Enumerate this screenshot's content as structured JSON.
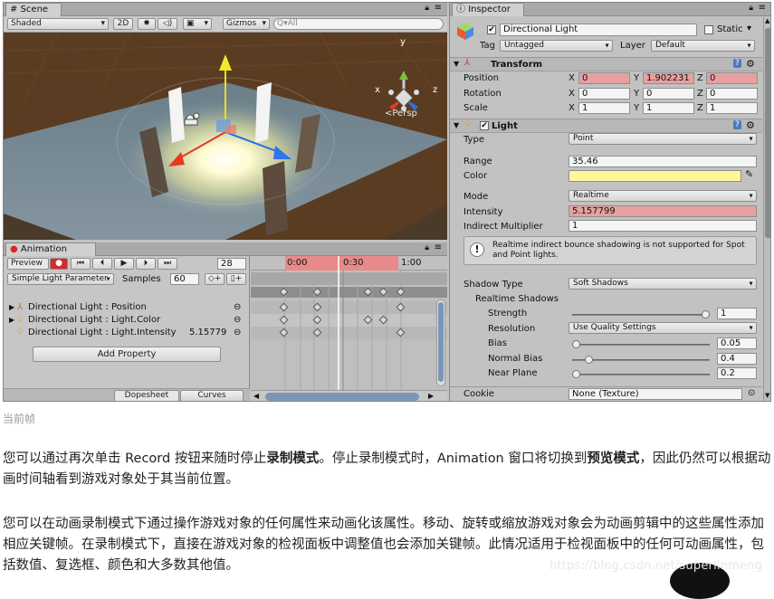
{
  "scene": {
    "tab": "Scene",
    "shading": "Shaded",
    "mode_2d": "2D",
    "gizmos": "Gizmos",
    "search_placeholder": "Q▾All",
    "persp": "<Persp",
    "axis_x": "x",
    "axis_y": "y",
    "axis_z": "z"
  },
  "animation": {
    "tab": "Animation",
    "preview": "Preview",
    "frame": "28",
    "clip": "Simple Light Parameter",
    "samples_label": "Samples",
    "samples": "60",
    "ruler": [
      "0:00",
      "0:30",
      "1:00"
    ],
    "properties": [
      {
        "label": "Directional Light : Position",
        "value": ""
      },
      {
        "label": "Directional Light : Light.Color",
        "value": ""
      },
      {
        "label": "Directional Light : Light.Intensity",
        "value": "5.15779"
      }
    ],
    "add_property": "Add Property",
    "dopesheet": "Dopesheet",
    "curves": "Curves"
  },
  "inspector": {
    "tab": "Inspector",
    "object_name": "Directional Light",
    "static_label": "Static",
    "tag_label": "Tag",
    "tag_value": "Untagged",
    "layer_label": "Layer",
    "layer_value": "Default",
    "transform": {
      "title": "Transform",
      "position_label": "Position",
      "rotation_label": "Rotation",
      "scale_label": "Scale",
      "x": "X",
      "y": "Y",
      "z": "Z",
      "position": [
        "0",
        "1.902231",
        "0"
      ],
      "rotation": [
        "0",
        "0",
        "0"
      ],
      "scale": [
        "1",
        "1",
        "1"
      ]
    },
    "light": {
      "title": "Light",
      "type_label": "Type",
      "type_value": "Point",
      "range_label": "Range",
      "range_value": "35.46",
      "color_label": "Color",
      "color_value": "#fff89a",
      "mode_label": "Mode",
      "mode_value": "Realtime",
      "intensity_label": "Intensity",
      "intensity_value": "5.157799",
      "indirect_label": "Indirect Multiplier",
      "indirect_value": "1",
      "warning": "Realtime indirect bounce shadowing is not supported for Spot and Point lights.",
      "shadow_type_label": "Shadow Type",
      "shadow_type_value": "Soft Shadows",
      "realtime_shadows_label": "Realtime Shadows",
      "strength_label": "Strength",
      "strength_value": "1",
      "strength_fraction": 1.0,
      "resolution_label": "Resolution",
      "resolution_value": "Use Quality Settings",
      "bias_label": "Bias",
      "bias_value": "0.05",
      "bias_fraction": 0.0,
      "normal_bias_label": "Normal Bias",
      "normal_bias_value": "0.4",
      "normal_bias_fraction": 0.1,
      "near_plane_label": "Near Plane",
      "near_plane_value": "0.2",
      "near_plane_fraction": 0.0,
      "cookie_label": "Cookie",
      "cookie_value": "None (Texture)"
    }
  },
  "doc": {
    "caption": "当前帧",
    "para1_a": "您可以通过再次单击 Record 按钮来随时停止",
    "para1_b": "录制模式",
    "para1_c": "。停止录制模式时，Animation 窗口将切换到",
    "para1_d": "预览模式",
    "para1_e": "，因此仍然可以根据动画时间轴看到游戏对象处于其当前位置。",
    "para2": "您可以在动画录制模式下通过操作游戏对象的任何属性来动画化该属性。移动、旋转或缩放游戏对象会为动画剪辑中的这些属性添加相应关键帧。在录制模式下，直接在游戏对象的检视面板中调整值也会添加关键帧。此情况适用于检视面板中的任何可动画属性，包括数值、复选框、颜色和大多数其他值。",
    "watermark": "https://blog.csdn.net/superlinmeng"
  },
  "colors": {
    "record_red": "#d42a2a",
    "key_field_red": "#e6a0a0",
    "timeline_red": "#e88a8a",
    "light_color": "#fff89a"
  }
}
